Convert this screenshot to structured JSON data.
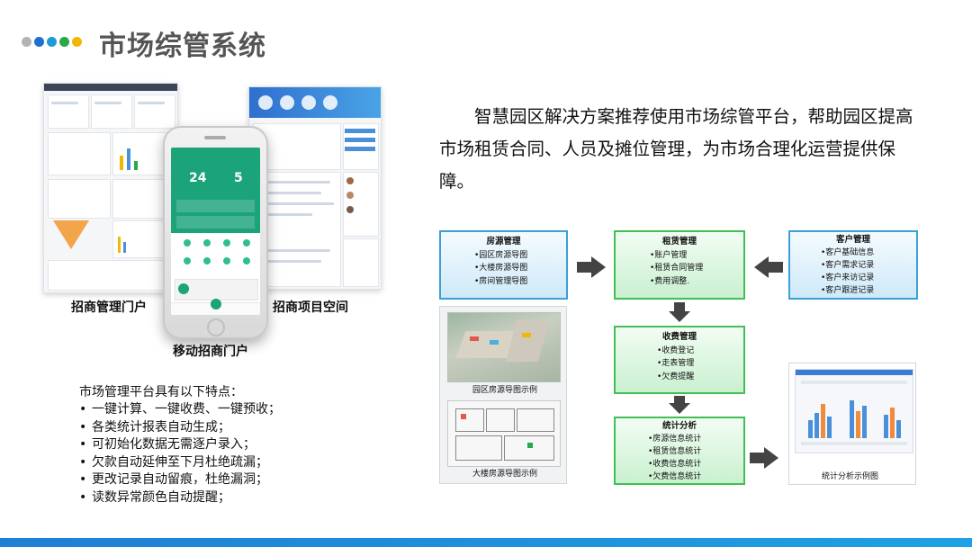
{
  "header": {
    "title": "市场综管系统",
    "dot_colors": [
      "#b3b3b3",
      "#1f6fd1",
      "#1f9ad6",
      "#2aa84a",
      "#f2b705"
    ]
  },
  "left_images": {
    "caption_left": "招商管理门户",
    "caption_right": "招商项目空间",
    "caption_center": "移动招商门户",
    "phone_stats": {
      "left_value": "24",
      "right_value": "5"
    }
  },
  "intro_text": "智慧园区解决方案推荐使用市场综管平台，帮助园区提高市场租赁合同、人员及摊位管理，为市场合理化运营提供保障。",
  "features": {
    "title": "市场管理平台具有以下特点：",
    "items": [
      "一键计算、一键收费、一键预收；",
      "各类统计报表自动生成；",
      "可初始化数据无需逐户录入；",
      "欠款自动延伸至下月杜绝疏漏；",
      "更改记录自动留痕，杜绝漏洞；",
      "读数异常颜色自动提醒；"
    ]
  },
  "flow": {
    "house": {
      "title": "房源管理",
      "items": [
        "•园区房源导图",
        "•大楼房源导图",
        "•房间管理导图"
      ]
    },
    "rent": {
      "title": "租赁管理",
      "items": [
        "•账户管理",
        "•租赁合同管理",
        "•费用调整."
      ]
    },
    "customer": {
      "title": "客户管理",
      "items": [
        "•客户基础信息",
        "•客户需求记录",
        "•客户来访记录",
        "•客户跟进记录"
      ]
    },
    "fee": {
      "title": "收费管理",
      "items": [
        "•收费登记",
        "•走表管理",
        "•欠费提醒"
      ]
    },
    "stats": {
      "title": "统计分析",
      "items": [
        "•房源信息统计",
        "•租赁信息统计",
        "•收费信息统计",
        "•欠费信息统计"
      ]
    },
    "caption_park": "园区房源导图示例",
    "caption_building": "大楼房源导图示例",
    "caption_stats": "统计分析示例图"
  },
  "colors": {
    "accent_blue": "#3ba0d6",
    "accent_green": "#3fbf55",
    "bottom_bar": "#1f7fd4"
  }
}
